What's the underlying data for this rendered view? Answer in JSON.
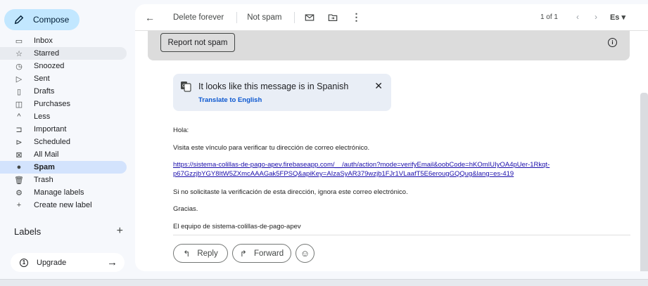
{
  "compose": {
    "label": "Compose"
  },
  "sidebar": {
    "items": [
      {
        "label": "Inbox",
        "icon": "inbox-icon"
      },
      {
        "label": "Starred",
        "icon": "star-icon"
      },
      {
        "label": "Snoozed",
        "icon": "clock-icon"
      },
      {
        "label": "Sent",
        "icon": "send-icon"
      },
      {
        "label": "Drafts",
        "icon": "draft-icon"
      },
      {
        "label": "Purchases",
        "icon": "bag-icon"
      },
      {
        "label": "Less",
        "icon": "chevron-up-icon"
      },
      {
        "label": "Important",
        "icon": "important-icon"
      },
      {
        "label": "Scheduled",
        "icon": "scheduled-icon"
      },
      {
        "label": "All Mail",
        "icon": "all-mail-icon"
      },
      {
        "label": "Spam",
        "icon": "spam-icon"
      },
      {
        "label": "Trash",
        "icon": "trash-icon"
      },
      {
        "label": "Manage labels",
        "icon": "gear-icon"
      },
      {
        "label": "Create new label",
        "icon": "plus-icon"
      }
    ],
    "labels_title": "Labels",
    "upgrade_label": "Upgrade"
  },
  "toolbar": {
    "delete_forever": "Delete forever",
    "not_spam": "Not spam",
    "pager": "1 of 1",
    "language": "Es"
  },
  "banner": {
    "report_not_spam": "Report not spam"
  },
  "translate": {
    "title": "It looks like this message is in Spanish",
    "link": "Translate to English"
  },
  "message": {
    "greeting": "Hola:",
    "line1": "Visita este vínculo para verificar tu dirección de correo electrónico.",
    "link_line1": "https://sistema-colillas-de-pago-apev.firebaseapp.com/__/auth/action?mode=verifyEmail&oobCode=hKOmIUIyOA4pUer-1Rkqt-",
    "link_line2": "p67GzzjbYGY8ItW5ZXmcAAAGak5FPSQ&apiKey=AIzaSyAR379wzjb1FJr1VLaafT5E6erougGQQug&lang=es-419",
    "line2": "Si no solicitaste la verificación de esta dirección, ignora este correo electrónico.",
    "thanks": "Gracias.",
    "signature": "El equipo de sistema-colillas-de-pago-apev"
  },
  "actions": {
    "reply": "Reply",
    "forward": "Forward"
  },
  "colors": {
    "compose_bg": "#c2e7ff",
    "active_bg": "#d3e3fd",
    "link": "#1a0dab"
  }
}
